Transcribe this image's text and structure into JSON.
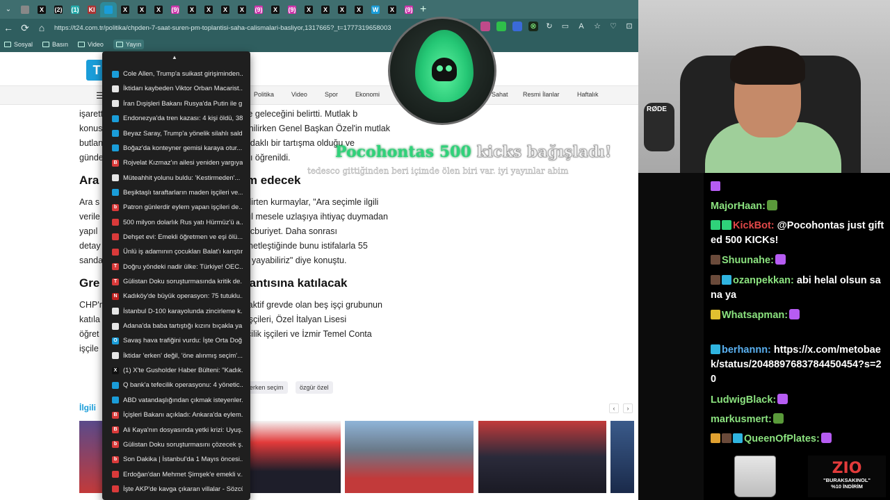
{
  "browser": {
    "tabs": [
      {
        "label": "",
        "active": false,
        "color": "#888"
      },
      {
        "label": "X",
        "active": false,
        "color": "#111"
      },
      {
        "label": "(2)",
        "active": false,
        "color": "#111"
      },
      {
        "label": "(1)",
        "active": false,
        "color": "#2aa"
      },
      {
        "label": "Kl",
        "active": false,
        "color": "#a33"
      },
      {
        "label": "",
        "active": true,
        "color": "#1a9dd9"
      },
      {
        "label": "X",
        "active": false,
        "color": "#111"
      },
      {
        "label": "X",
        "active": false,
        "color": "#111"
      },
      {
        "label": "X",
        "active": false,
        "color": "#111"
      },
      {
        "label": "(9)",
        "active": false,
        "color": "#c3a"
      },
      {
        "label": "X",
        "active": false,
        "color": "#111"
      },
      {
        "label": "X",
        "active": false,
        "color": "#111"
      },
      {
        "label": "X",
        "active": false,
        "color": "#111"
      },
      {
        "label": "X",
        "active": false,
        "color": "#111"
      },
      {
        "label": "(9)",
        "active": false,
        "color": "#c3a"
      },
      {
        "label": "X",
        "active": false,
        "color": "#111"
      },
      {
        "label": "(9)",
        "active": false,
        "color": "#c3a"
      },
      {
        "label": "X",
        "active": false,
        "color": "#111"
      },
      {
        "label": "X",
        "active": false,
        "color": "#111"
      },
      {
        "label": "X",
        "active": false,
        "color": "#111"
      },
      {
        "label": "X",
        "active": false,
        "color": "#111"
      },
      {
        "label": "W",
        "active": false,
        "color": "#1a9dd9"
      },
      {
        "label": "X",
        "active": false,
        "color": "#111"
      },
      {
        "label": "(9)",
        "active": false,
        "color": "#c3a"
      }
    ],
    "url": "https://t24.com.tr/politika/chpden-7-saat-suren-pm-toplantisi-saha-calismalari-basliyor,1317665?_t=1777319658003",
    "bookmarks": [
      "Sosyal",
      "Basın",
      "Video",
      "Yayın"
    ]
  },
  "site": {
    "logo": "T",
    "nav": [
      "Politika",
      "Video",
      "Spor",
      "Ekonomi",
      "Sahat",
      "Resmi İlanlar",
      "Haftalık"
    ],
    "paragraphs": [
      "işarett                                          da gündeme geleceğini belirtti. Mutlak b",
      "konus                                            rildiği öğrenilirken Genel Başkan Özel'in mutlak",
      "butlan                                           ere süreç odaklı bir tartışma olduğu ve",
      "günde                                            vurguladığı öğrenildi."
    ],
    "heading1": "Ara                                       evam edecek",
    "paragraphs2": [
      "Ara s                                        edileceğini belirten kurmaylar, \"Ara seçimle ilgili",
      "verile                                       etki yarattı. Asıl mesele uzlaşıya ihtiyaç duymadan",
      "yapıl                                        a seçim. O mecburiyet. Daha sonrası",
      "detay                                        im yapılması netleştiğinde bunu istifalarla 55",
      "sanda                                        ir coğrafyaya yayabiliriz\" diye konuştu."
    ],
    "heading2": "Gre                                       toplantısına katılacak",
    "paragraphs3": [
      "CHP'n                                        toplantısına aktif grevde olan beş işçi grubunun",
      "katıla                                       ık Madencilik işçileri, Özel İtalyan Lisesi",
      "öğret                                        Çiftay Madencilik işçileri ve İzmir Temel Conta",
      "işçile                                       cak."
    ],
    "tags": [
      "erken seçim",
      "özgür özel"
    ],
    "related_title": "İlgili",
    "related_prev": "‹",
    "related_next": "›"
  },
  "history_menu": [
    {
      "text": "Cole Allen, Trump'a suikast girişiminden...",
      "color": "#1a9dd9",
      "icon": ""
    },
    {
      "text": "İktidarı kaybeden Viktor Orban Macarist...",
      "color": "#e6e6e6",
      "icon": ""
    },
    {
      "text": "İran Dışişleri Bakanı Rusya'da Putin ile g...",
      "color": "#e6e6e6",
      "icon": ""
    },
    {
      "text": "Endonezya'da tren kazası: 4 kişi öldü, 38...",
      "color": "#1a9dd9",
      "icon": ""
    },
    {
      "text": "Beyaz Saray, Trump'a yönelik silahlı saldı...",
      "color": "#1a9dd9",
      "icon": ""
    },
    {
      "text": "Boğaz'da konteyner gemisi karaya otur...",
      "color": "#1a9dd9",
      "icon": ""
    },
    {
      "text": "Rojvelat Kızmaz'ın ailesi yeniden yargıya...",
      "color": "#d93a3a",
      "icon": "B"
    },
    {
      "text": "Müteahhit yolunu buldu: 'Kestirmeden'...",
      "color": "#e6e6e6",
      "icon": ""
    },
    {
      "text": "Beşiktaşlı taraftarların maden işçileri ve...",
      "color": "#1a9dd9",
      "icon": ""
    },
    {
      "text": "Patron günlerdir eylem yapan işçileri de...",
      "color": "#d93a3a",
      "icon": "b"
    },
    {
      "text": "500 milyon dolarlık Rus yatı Hürmüz'ü a...",
      "color": "#d93a3a",
      "icon": ""
    },
    {
      "text": "Dehşet evi: Emekli öğretmen ve eşi ölü...",
      "color": "#d93a3a",
      "icon": ""
    },
    {
      "text": "Ünlü iş adamının çocukları Balat'ı karıştır...",
      "color": "#d93a3a",
      "icon": ""
    },
    {
      "text": "Doğru yöndeki nadir ülke: Türkiye! OEC...",
      "color": "#d93a3a",
      "icon": "T"
    },
    {
      "text": "Gülistan Doku soruşturmasında kritik de...",
      "color": "#d93a3a",
      "icon": "T"
    },
    {
      "text": "Kadıköy'de büyük operasyon: 75 tutuklu...",
      "color": "#c0201e",
      "icon": "N"
    },
    {
      "text": "İstanbul D-100 karayolunda zincirleme k...",
      "color": "#e6e6e6",
      "icon": ""
    },
    {
      "text": "Adana'da baba tartıştığı kızını bıçakla ya...",
      "color": "#e6e6e6",
      "icon": ""
    },
    {
      "text": "Savaş hava trafiğini vurdu: İşte Orta Doğ...",
      "color": "#1a9dd9",
      "icon": "O"
    },
    {
      "text": "İktidar 'erken' değil, 'öne alınmış seçim'...",
      "color": "#e6e6e6",
      "icon": ""
    },
    {
      "text": "(1) X'te Gusholder Haber Bülteni: \"Kadık...",
      "color": "#111",
      "icon": "X"
    },
    {
      "text": "Q bank'a tefecilik operasyonu: 4 yönetic...",
      "color": "#1a9dd9",
      "icon": ""
    },
    {
      "text": "ABD vatandaşlığından çıkmak isteyenler...",
      "color": "#1a9dd9",
      "icon": ""
    },
    {
      "text": "İçişleri Bakanı açıkladı: Ankara'da eylem...",
      "color": "#d93a3a",
      "icon": "B"
    },
    {
      "text": "Ali Kaya'nın dosyasında yetki krizi: Uyuş...",
      "color": "#d93a3a",
      "icon": "B"
    },
    {
      "text": "Gülistan Doku soruşturmasını çözecek ş...",
      "color": "#d93a3a",
      "icon": "b"
    },
    {
      "text": "Son Dakika | İstanbul'da 1 Mayıs öncesi...",
      "color": "#d93a3a",
      "icon": "b"
    },
    {
      "text": "Erdoğan'dan Mehmet Şimşek'e emekli v...",
      "color": "#d93a3a",
      "icon": ""
    },
    {
      "text": "İşte AKP'de kavga çıkaran villalar - Sözcü",
      "color": "#d93a3a",
      "icon": ""
    }
  ],
  "overlay": {
    "name": "Pocohontas",
    "amount": "500",
    "rest": "kicks bağışladı!",
    "message": "tedesco gittiğinden beri içimde ölen biri var. iyi yayınlar abim"
  },
  "webcam": {
    "mic_brand": "RØDE"
  },
  "chat": [
    {
      "user": "",
      "text": "",
      "badges": [
        "#b65cf2"
      ]
    },
    {
      "user": "MajorHaan:",
      "text": "",
      "badges": [],
      "emote": "#5a9a3a"
    },
    {
      "user": "KickBot:",
      "text": "@Pocohontas just gifted 500 KICKs!",
      "badges": [
        "#2fd27a",
        "#2fd27a"
      ],
      "user_color": "#e04848"
    },
    {
      "user": "Shuunahe:",
      "text": "",
      "badges": [
        "#6a4a3a"
      ],
      "emote": "#b65cf2"
    },
    {
      "user": "ozanpekkan:",
      "text": "abi helal olsun sana ya",
      "badges": [
        "#6a4a3a",
        "#2fb4e0"
      ]
    },
    {
      "user": "Whatsapman:",
      "text": "",
      "badges": [
        "#e0c030"
      ],
      "emote": "#b65cf2"
    },
    {
      "user": "berhannn:",
      "text": "https://x.com/metobaek/status/2048897683784450454?s=20",
      "badges": [
        "#2fb4e0"
      ],
      "user_color": "#5ab0f0"
    },
    {
      "user": "LudwigBlack:",
      "text": "",
      "badges": [],
      "emote": "#b65cf2"
    },
    {
      "user": "markusmert:",
      "text": "",
      "badges": [],
      "emote": "#5a9a3a"
    },
    {
      "user": "QueenOfPlates:",
      "text": "",
      "badges": [
        "#e0a030",
        "#6a4a3a",
        "#2fb4e0"
      ],
      "emote": "#b65cf2"
    }
  ],
  "sponsor": {
    "logo": "ZIO",
    "line1": "\"BURAKSAKINOL\"",
    "line2": "%10 İNDİRİM"
  }
}
